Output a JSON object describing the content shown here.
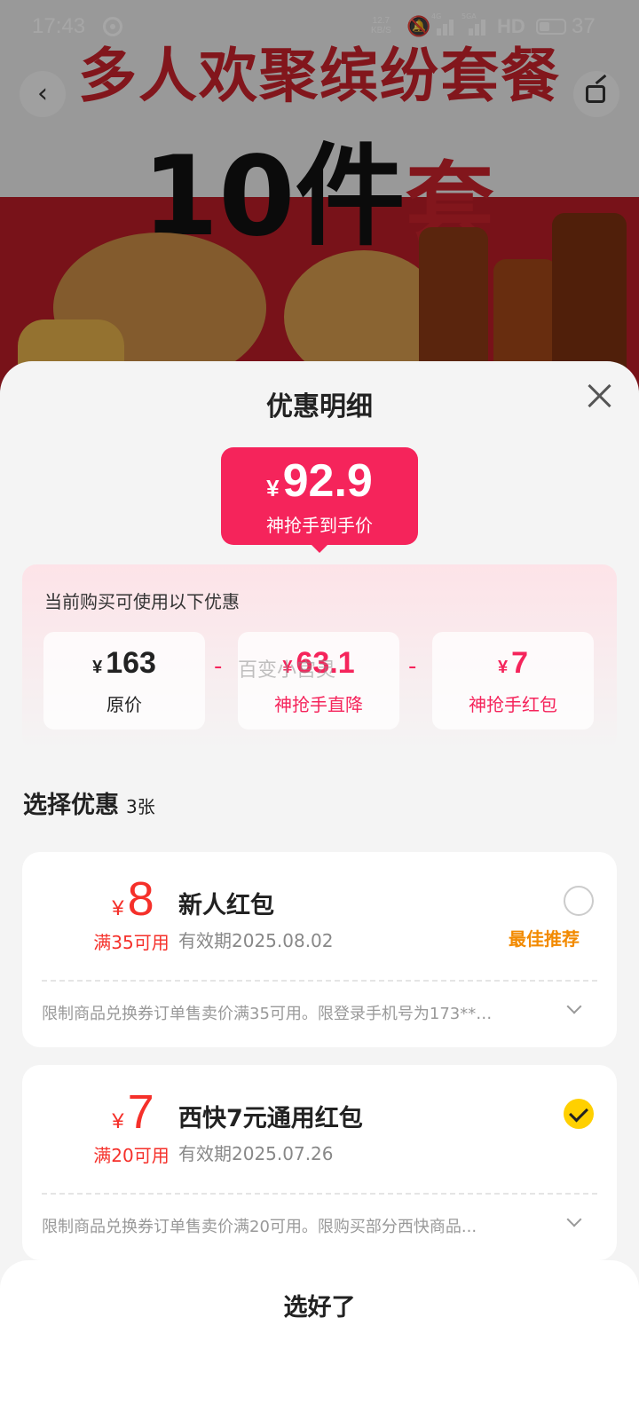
{
  "status_bar": {
    "time": "17:43",
    "net_speed_value": "12.7",
    "net_speed_unit": "KB/S",
    "signal1_label": "4G",
    "signal2_label": "5GA",
    "hd_label": "HD",
    "battery": "37"
  },
  "hero": {
    "title": "多人欢聚缤纷套餐",
    "subtitle_main": "10件",
    "subtitle_red": "套"
  },
  "sheet": {
    "title": "优惠明细",
    "final_price": {
      "currency": "¥",
      "amount": "92.9",
      "label": "神抢手到手价"
    },
    "summary": {
      "heading": "当前购买可使用以下优惠",
      "items": [
        {
          "currency": "¥",
          "value": "163",
          "label": "原价"
        },
        {
          "currency": "¥",
          "value": "63.1",
          "label": "神抢手直降"
        },
        {
          "currency": "¥",
          "value": "7",
          "label": "神抢手红包"
        }
      ],
      "operator": "-"
    },
    "watermark": "百变小宫灵",
    "select": {
      "title": "选择优惠",
      "count": "3张"
    },
    "coupons": [
      {
        "currency": "¥",
        "value": "8",
        "condition": "满35可用",
        "name": "新人红包",
        "expiry": "有效期2025.08.02",
        "selected": false,
        "badge": "最佳推荐",
        "description": "限制商品兑换券订单售卖价满35可用。限登录手机号为173**…"
      },
      {
        "currency": "¥",
        "value": "7",
        "condition": "满20可用",
        "name": "西快7元通用红包",
        "expiry": "有效期2025.07.26",
        "selected": true,
        "badge": "",
        "description": "限制商品兑换券订单售卖价满20可用。限购买部分西快商品..."
      }
    ],
    "confirm_button": "选好了"
  },
  "colors": {
    "accent_pink": "#f5245b",
    "coupon_red": "#f5302a",
    "recommend_orange": "#f28a00",
    "check_yellow": "#ffd000"
  },
  "icons": [
    "back-arrow-icon",
    "share-icon",
    "close-icon",
    "radio-unchecked-icon",
    "checkmark-icon",
    "chevron-down-icon"
  ]
}
